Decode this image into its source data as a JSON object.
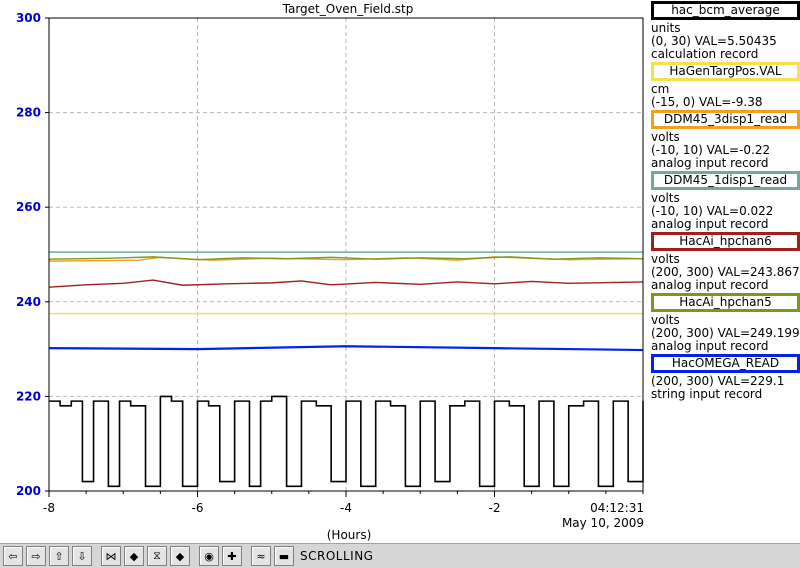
{
  "chart_data": {
    "type": "line",
    "title": "Target_Oven_Field.stp",
    "xlabel": "(Hours)",
    "ylabel": "",
    "xlim": [
      -8,
      0
    ],
    "ylim": [
      200,
      300
    ],
    "yticks": [
      200,
      220,
      240,
      260,
      280,
      300
    ],
    "xticks": [
      -8,
      -6,
      -4,
      -2
    ],
    "ytick_labels": [
      "200",
      "220",
      "240",
      "260",
      "280",
      "300"
    ],
    "xtick_labels": [
      "-8",
      "-6",
      "-4",
      "-2"
    ],
    "time_label": "04:12:31",
    "date_label": "May 10, 2009",
    "grid": true,
    "series": [
      {
        "name": "HaGenTargPos.VAL",
        "color": "#f5e050",
        "x": [
          -8,
          0
        ],
        "y": [
          237.5,
          237.5
        ]
      },
      {
        "name": "DDM45_3disp1_read",
        "color": "#f0a020",
        "x": [
          -8,
          -6.8,
          -6.5,
          -5.8,
          -5,
          -4,
          -3.2,
          -2.5,
          -2,
          -1,
          0
        ],
        "y": [
          248.6,
          248.8,
          249.4,
          248.8,
          249.2,
          248.9,
          249.3,
          248.8,
          249.5,
          248.9,
          249.1
        ]
      },
      {
        "name": "DDM45_1disp1_read",
        "color": "#70a8a0",
        "x": [
          -8,
          0
        ],
        "y": [
          250.5,
          250.5
        ]
      },
      {
        "name": "HacAi_hpchan6",
        "color": "#a02020",
        "x": [
          -8,
          -7.5,
          -7,
          -6.6,
          -6.2,
          -5.6,
          -5,
          -4.6,
          -4.2,
          -3.6,
          -3,
          -2.5,
          -2,
          -1.5,
          -1,
          0
        ],
        "y": [
          243.1,
          243.6,
          243.9,
          244.6,
          243.5,
          243.8,
          244.0,
          244.4,
          243.6,
          244.1,
          243.7,
          244.2,
          243.8,
          244.3,
          243.9,
          244.2
        ]
      },
      {
        "name": "HacAi_hpchan5",
        "color": "#789820",
        "x": [
          -8,
          -7.2,
          -6.6,
          -6,
          -5.4,
          -4.8,
          -4.2,
          -3.6,
          -3,
          -2.4,
          -1.8,
          -1.2,
          -0.6,
          0
        ],
        "y": [
          249.0,
          249.2,
          249.5,
          248.9,
          249.3,
          249.1,
          249.4,
          249.0,
          249.3,
          249.1,
          249.5,
          249.0,
          249.3,
          249.1
        ]
      },
      {
        "name": "HacOMEGA_READ",
        "color": "#0022ee",
        "x": [
          -8,
          -6,
          -4,
          -2,
          0
        ],
        "y": [
          230.2,
          230.0,
          230.6,
          230.2,
          229.8
        ]
      },
      {
        "name": "hac_bcm_average",
        "color": "#000000",
        "x": [
          -8,
          -7.85,
          -7.7,
          -7.55,
          -7.4,
          -7.2,
          -7.05,
          -6.9,
          -6.7,
          -6.5,
          -6.35,
          -6.2,
          -6.0,
          -5.85,
          -5.7,
          -5.5,
          -5.3,
          -5.15,
          -5.0,
          -4.8,
          -4.6,
          -4.4,
          -4.2,
          -4.0,
          -3.8,
          -3.6,
          -3.4,
          -3.2,
          -3.0,
          -2.8,
          -2.6,
          -2.4,
          -2.2,
          -2.0,
          -1.8,
          -1.6,
          -1.4,
          -1.2,
          -1.0,
          -0.8,
          -0.6,
          -0.4,
          -0.2,
          0
        ],
        "y": [
          219,
          218,
          219,
          202,
          219,
          201,
          219,
          218,
          201,
          220,
          219,
          201,
          219,
          218,
          202,
          219,
          201,
          219,
          220,
          201,
          219,
          218,
          202,
          219,
          201,
          219,
          218,
          201,
          219,
          202,
          218,
          219,
          201,
          219,
          218,
          201,
          219,
          201,
          218,
          219,
          201,
          219,
          202,
          219
        ]
      }
    ]
  },
  "legend": [
    {
      "name": "hac_bcm_average",
      "color": "#000000",
      "lines": [
        "units",
        "(0, 30) VAL=5.50435",
        "calculation record"
      ]
    },
    {
      "name": "HaGenTargPos.VAL",
      "color": "#f5e050",
      "lines": [
        "cm",
        "(-15, 0) VAL=-9.38"
      ]
    },
    {
      "name": "DDM45_3disp1_read",
      "color": "#f0a020",
      "lines": [
        "volts",
        "(-10, 10) VAL=-0.22",
        "analog input record"
      ]
    },
    {
      "name": "DDM45_1disp1_read",
      "color": "#70a8a0",
      "lines": [
        "volts",
        "(-10, 10) VAL=0.022",
        "analog input record"
      ]
    },
    {
      "name": "HacAi_hpchan6",
      "color": "#a02020",
      "lines": [
        "volts",
        "(200, 300) VAL=243.867",
        "analog input record"
      ]
    },
    {
      "name": "HacAi_hpchan5",
      "color": "#789820",
      "lines": [
        "volts",
        "(200, 300) VAL=249.199",
        "analog input record"
      ]
    },
    {
      "name": "HacOMEGA_READ",
      "color": "#0022ee",
      "lines": [
        "(200, 300) VAL=229.1",
        "string input record"
      ]
    }
  ],
  "toolbar": {
    "buttons": [
      {
        "name": "scroll-left-icon",
        "glyph": "⇦"
      },
      {
        "name": "scroll-right-icon",
        "glyph": "⇨"
      },
      {
        "name": "scroll-up-icon",
        "glyph": "⇧"
      },
      {
        "name": "scroll-down-icon",
        "glyph": "⇩"
      },
      {
        "name": "zoom-in-x-icon",
        "glyph": "⋈"
      },
      {
        "name": "zoom-out-x-icon",
        "glyph": "◆"
      },
      {
        "name": "zoom-in-y-icon",
        "glyph": "⧖"
      },
      {
        "name": "zoom-out-y-icon",
        "glyph": "◆"
      },
      {
        "name": "auto-scale-icon",
        "glyph": "◉"
      },
      {
        "name": "add-icon",
        "glyph": "✚"
      },
      {
        "name": "config-icon",
        "glyph": "≈"
      },
      {
        "name": "print-icon",
        "glyph": "▬"
      }
    ],
    "status": "SCROLLING"
  }
}
